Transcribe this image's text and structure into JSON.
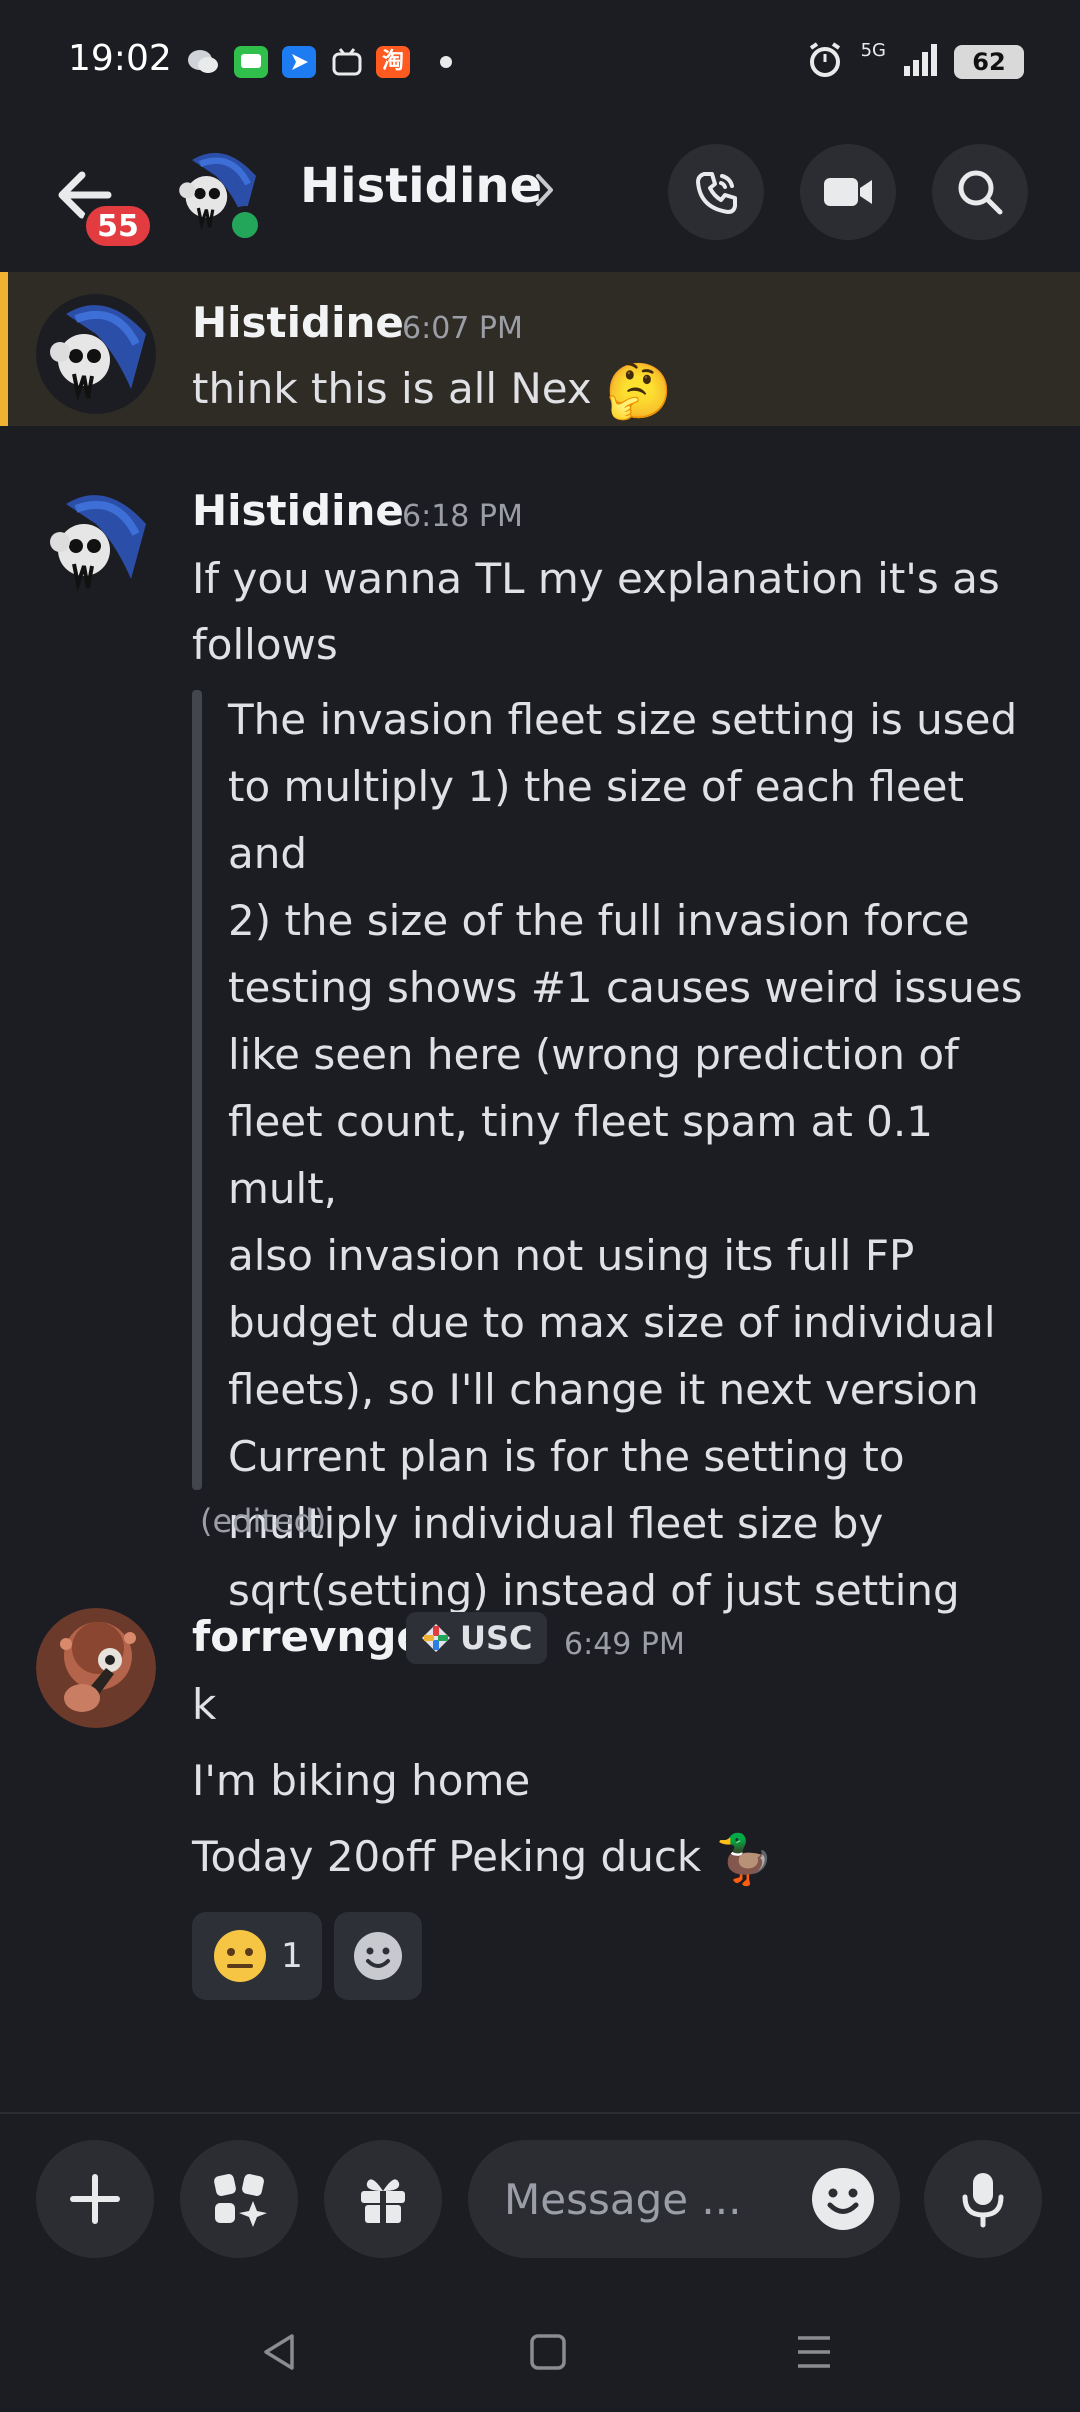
{
  "status_bar": {
    "time": "19:02",
    "network": "5G",
    "battery": "62",
    "notification_icons": [
      "wechat-icon",
      "messages-icon",
      "feishu-icon",
      "bilibili-icon",
      "taobao-icon"
    ]
  },
  "header": {
    "title": "Histidine",
    "unread_count": "55",
    "presence": "online"
  },
  "messages": [
    {
      "author": "Histidine",
      "time": "6:07 PM",
      "text": "think this is all Nex",
      "emoji": "🤔",
      "highlighted": true
    },
    {
      "author": "Histidine",
      "time": "6:18 PM",
      "text": "If you wanna TL my explanation it's as follows",
      "quote_lines": [
        "The invasion fleet size setting is used",
        "to multiply 1) the size of each fleet and",
        "2) the size of the full invasion force",
        "testing shows #1 causes weird issues",
        "like seen here (wrong prediction of",
        "fleet count, tiny fleet spam at 0.1 mult,",
        "also invasion not using its full FP",
        "budget due to max size of individual",
        "fleets), so I'll change it next version",
        "Current plan is for the setting to",
        "multiply individual fleet size by",
        "sqrt(setting) instead of just setting"
      ],
      "edited_label": "(edited)"
    },
    {
      "author": "forrevnge",
      "tag": "USC",
      "time": "6:49 PM",
      "lines": [
        "k",
        "I'm biking home",
        "Today 20off Peking duck"
      ],
      "duck_emoji": "🦆",
      "reactions": [
        {
          "emoji": "😐",
          "count": "1"
        }
      ]
    }
  ],
  "input": {
    "placeholder": "Message ..."
  },
  "colors": {
    "background": "#1c1d22",
    "highlight_bar": "#f0b232",
    "unread_badge": "#e23c41",
    "online": "#23a55a"
  }
}
